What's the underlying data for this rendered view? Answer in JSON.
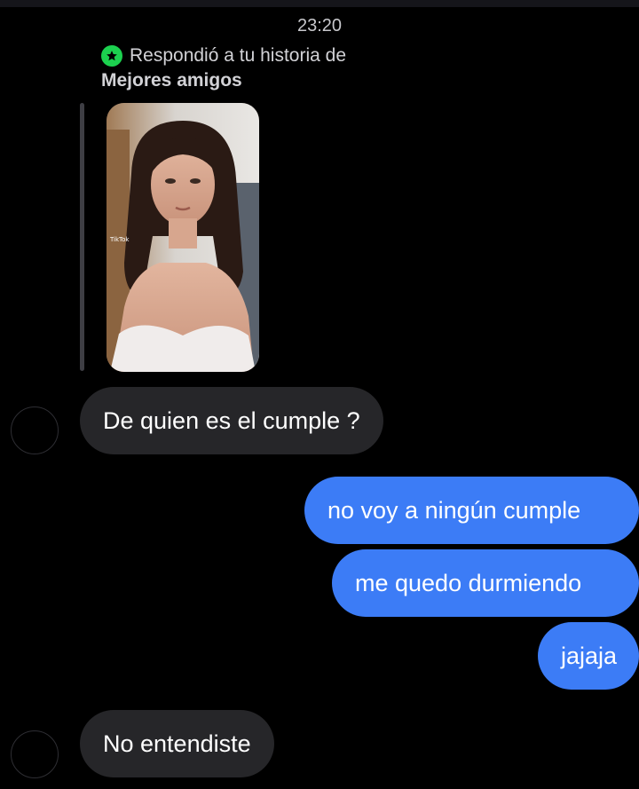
{
  "thread": {
    "timestamp": "23:20",
    "story_reply": {
      "label": "Respondió a tu historia de",
      "audience": "Mejores amigos",
      "badge_icon": "star-icon",
      "badge_color": "#1cd14f",
      "thumbnail_watermark": "TikTok"
    }
  },
  "messages": [
    {
      "sender": "them",
      "text": "De quien es el cumple ?"
    },
    {
      "sender": "me",
      "text": "no voy a ningún cumple"
    },
    {
      "sender": "me",
      "text": "me quedo durmiendo"
    },
    {
      "sender": "me",
      "text": "jajaja"
    },
    {
      "sender": "them",
      "text": "No entendiste"
    }
  ],
  "colors": {
    "background": "#000000",
    "incoming_bubble": "#262629",
    "outgoing_bubble": "#3c7cf6"
  }
}
